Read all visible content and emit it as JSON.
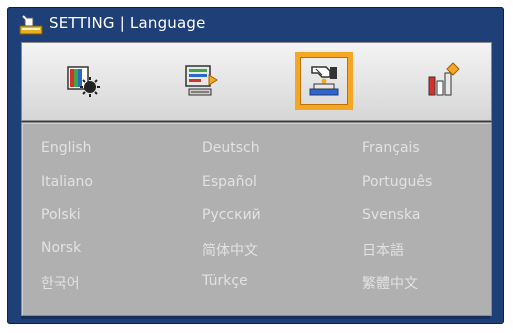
{
  "window": {
    "title": "SETTING | Language"
  },
  "tabs": [
    {
      "icon": "image-settings-icon",
      "active": false
    },
    {
      "icon": "display-settings-icon",
      "active": false
    },
    {
      "icon": "setting-icon",
      "active": true
    },
    {
      "icon": "options-icon",
      "active": false
    }
  ],
  "languages": [
    [
      "English",
      "Deutsch",
      "Français"
    ],
    [
      "Italiano",
      "Español",
      "Português"
    ],
    [
      "Polski",
      "Русский",
      "Svenska"
    ],
    [
      "Norsk",
      "简体中文",
      "日本語"
    ],
    [
      "한국어",
      "Türkçe",
      "繁體中文"
    ]
  ],
  "colors": {
    "frame": "#1f3f78",
    "highlight": "#f5a623",
    "content_bg": "#b0b0b0",
    "text": "#e2e2e2"
  }
}
